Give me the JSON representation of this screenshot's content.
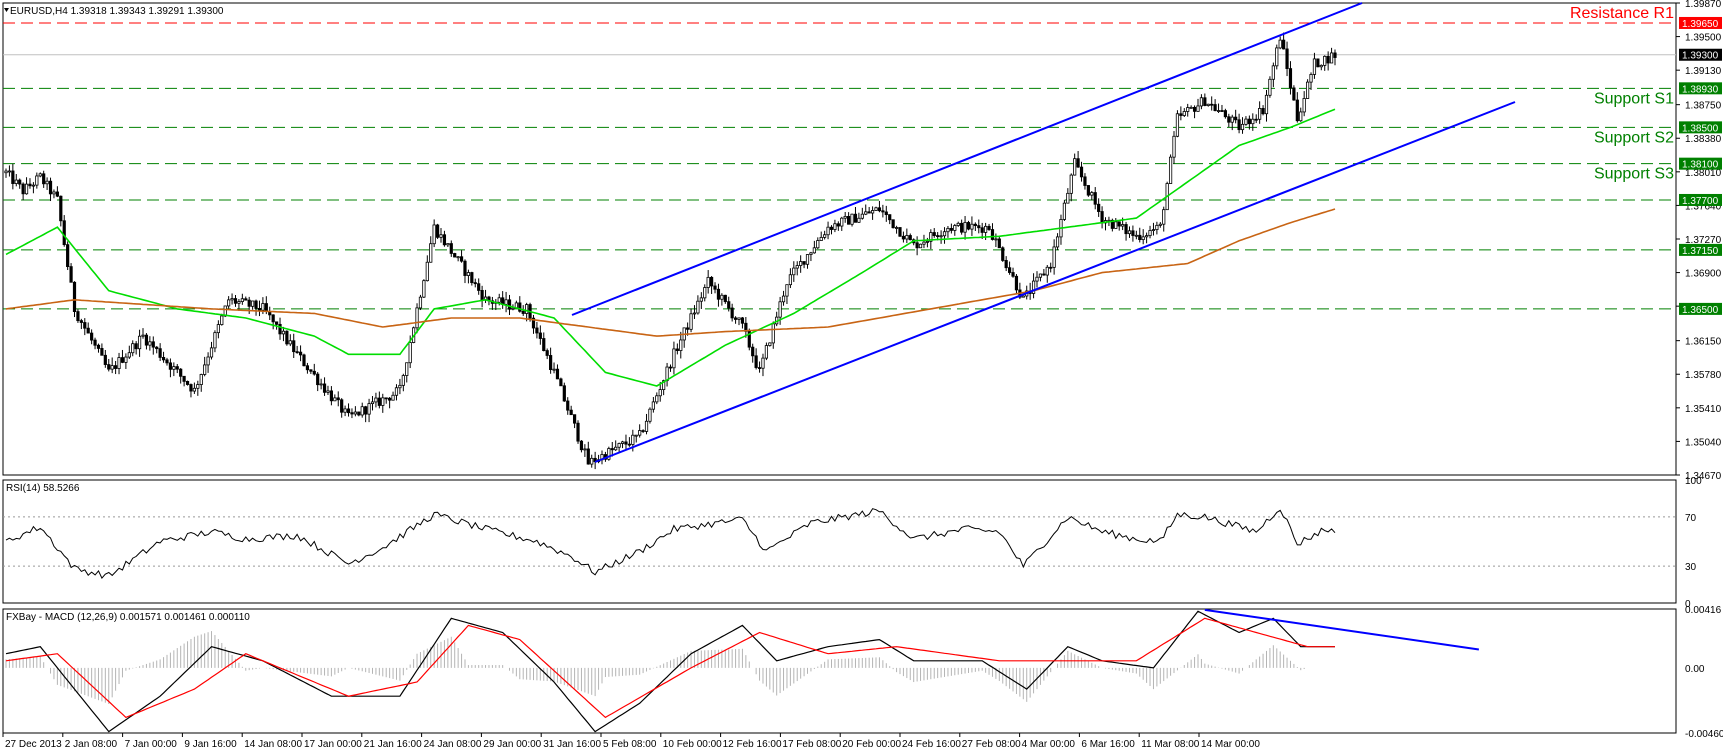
{
  "header": {
    "symbol_line": "EURUSD,H4  1.39318 1.39343 1.39291 1.39300",
    "rsi_label": "RSI(14) 58.5266",
    "macd_label": "FXBay - MACD (12,26,9) 0.001571 0.001461 0.000110"
  },
  "levels": {
    "resistance_r1": {
      "label": "Resistance R1",
      "value": 1.3965,
      "tag": "1.39650"
    },
    "support_s1": {
      "label": "Support S1",
      "value": 1.3893,
      "tag": "1.38930"
    },
    "support_s2": {
      "label": "Support S2",
      "value": 1.385,
      "tag": "1.38500"
    },
    "support_s3": {
      "label": "Support S3",
      "value": 1.381,
      "tag": "1.38100"
    },
    "level_1": {
      "value": 1.377,
      "tag": "1.37700"
    },
    "level_2": {
      "value": 1.3715,
      "tag": "1.37150"
    },
    "level_3": {
      "value": 1.365,
      "tag": "1.36500"
    },
    "current": {
      "value": 1.393,
      "tag": "1.39300"
    }
  },
  "colors": {
    "resistance": "#ff0000",
    "support": "#008000",
    "channel": "#0000ff",
    "ma_fast": "#00dd00",
    "ma_slow": "#c86414",
    "macd_signal": "#ff0000",
    "macd_main": "#000000",
    "histogram": "#b4b4b4"
  },
  "chart_data": [
    {
      "type": "candlestick",
      "title": "EURUSD,H4",
      "ylim": [
        1.3467,
        1.3987
      ],
      "y_ticks": [
        "1.39870",
        "1.39500",
        "1.39130",
        "1.38750",
        "1.38380",
        "1.38010",
        "1.37640",
        "1.37270",
        "1.36900",
        "1.36530",
        "1.36150",
        "1.35780",
        "1.35410",
        "1.35040",
        "1.34670"
      ],
      "x_ticks": [
        "27 Dec 2013",
        "2 Jan 08:00",
        "7 Jan 00:00",
        "9 Jan 16:00",
        "14 Jan 08:00",
        "17 Jan 00:00",
        "21 Jan 16:00",
        "24 Jan 08:00",
        "29 Jan 00:00",
        "31 Jan 16:00",
        "5 Feb 08:00",
        "10 Feb 00:00",
        "12 Feb 16:00",
        "17 Feb 08:00",
        "20 Feb 00:00",
        "24 Feb 16:00",
        "27 Feb 08:00",
        "4 Mar 00:00",
        "6 Mar 16:00",
        "11 Mar 08:00",
        "14 Mar 00:00"
      ],
      "price_keypoints": [
        [
          0,
          1.38
        ],
        [
          5,
          1.378
        ],
        [
          10,
          1.3795
        ],
        [
          15,
          1.377
        ],
        [
          20,
          1.365
        ],
        [
          30,
          1.358
        ],
        [
          40,
          1.362
        ],
        [
          55,
          1.356
        ],
        [
          65,
          1.366
        ],
        [
          75,
          1.365
        ],
        [
          85,
          1.36
        ],
        [
          100,
          1.353
        ],
        [
          115,
          1.356
        ],
        [
          125,
          1.374
        ],
        [
          140,
          1.366
        ],
        [
          152,
          1.365
        ],
        [
          160,
          1.358
        ],
        [
          170,
          1.348
        ],
        [
          185,
          1.351
        ],
        [
          195,
          1.36
        ],
        [
          205,
          1.368
        ],
        [
          215,
          1.363
        ],
        [
          220,
          1.358
        ],
        [
          228,
          1.368
        ],
        [
          240,
          1.374
        ],
        [
          255,
          1.376
        ],
        [
          265,
          1.372
        ],
        [
          275,
          1.374
        ],
        [
          287,
          1.374
        ],
        [
          297,
          1.366
        ],
        [
          305,
          1.37
        ],
        [
          312,
          1.381
        ],
        [
          320,
          1.375
        ],
        [
          330,
          1.373
        ],
        [
          337,
          1.374
        ],
        [
          342,
          1.386
        ],
        [
          350,
          1.388
        ],
        [
          360,
          1.385
        ],
        [
          367,
          1.387
        ],
        [
          372,
          1.395
        ],
        [
          377,
          1.386
        ],
        [
          382,
          1.392
        ],
        [
          388,
          1.393
        ]
      ],
      "series": [
        {
          "name": "MA fast",
          "keypoints": [
            [
              0,
              1.371
            ],
            [
              15,
              1.374
            ],
            [
              30,
              1.367
            ],
            [
              50,
              1.365
            ],
            [
              70,
              1.364
            ],
            [
              90,
              1.362
            ],
            [
              100,
              1.36
            ],
            [
              115,
              1.36
            ],
            [
              125,
              1.365
            ],
            [
              140,
              1.366
            ],
            [
              160,
              1.364
            ],
            [
              175,
              1.358
            ],
            [
              190,
              1.3565
            ],
            [
              210,
              1.361
            ],
            [
              230,
              1.3645
            ],
            [
              250,
              1.369
            ],
            [
              265,
              1.3725
            ],
            [
              290,
              1.373
            ],
            [
              310,
              1.374
            ],
            [
              330,
              1.375
            ],
            [
              345,
              1.379
            ],
            [
              360,
              1.383
            ],
            [
              375,
              1.385
            ],
            [
              388,
              1.387
            ]
          ]
        },
        {
          "name": "MA slow",
          "keypoints": [
            [
              0,
              1.365
            ],
            [
              20,
              1.366
            ],
            [
              40,
              1.3655
            ],
            [
              60,
              1.365
            ],
            [
              90,
              1.3645
            ],
            [
              110,
              1.363
            ],
            [
              130,
              1.364
            ],
            [
              150,
              1.364
            ],
            [
              170,
              1.363
            ],
            [
              190,
              1.362
            ],
            [
              210,
              1.3625
            ],
            [
              240,
              1.363
            ],
            [
              270,
              1.365
            ],
            [
              300,
              1.367
            ],
            [
              320,
              1.369
            ],
            [
              345,
              1.37
            ],
            [
              360,
              1.3725
            ],
            [
              375,
              1.3745
            ],
            [
              388,
              1.376
            ]
          ]
        }
      ]
    },
    {
      "type": "line",
      "title": "RSI(14) 58.5266",
      "ylim": [
        0,
        100
      ],
      "y_ticks": [
        "100",
        "70",
        "30",
        "0"
      ],
      "keypoints": [
        [
          0,
          50
        ],
        [
          10,
          62
        ],
        [
          20,
          28
        ],
        [
          30,
          22
        ],
        [
          45,
          50
        ],
        [
          60,
          58
        ],
        [
          70,
          52
        ],
        [
          85,
          55
        ],
        [
          100,
          32
        ],
        [
          110,
          45
        ],
        [
          125,
          72
        ],
        [
          140,
          60
        ],
        [
          155,
          50
        ],
        [
          165,
          38
        ],
        [
          172,
          25
        ],
        [
          185,
          42
        ],
        [
          195,
          60
        ],
        [
          215,
          68
        ],
        [
          222,
          42
        ],
        [
          235,
          65
        ],
        [
          255,
          75
        ],
        [
          265,
          52
        ],
        [
          280,
          60
        ],
        [
          290,
          58
        ],
        [
          297,
          30
        ],
        [
          310,
          70
        ],
        [
          320,
          58
        ],
        [
          330,
          52
        ],
        [
          337,
          50
        ],
        [
          342,
          72
        ],
        [
          350,
          70
        ],
        [
          365,
          58
        ],
        [
          372,
          78
        ],
        [
          377,
          48
        ],
        [
          385,
          60
        ],
        [
          388,
          58
        ]
      ]
    },
    {
      "type": "line",
      "title": "FXBay - MACD (12,26,9)",
      "ylim": [
        -0.0046,
        0.00416
      ],
      "y_ticks": [
        "0.00416",
        "0.00",
        "-0.004601"
      ],
      "series": [
        {
          "name": "MACD",
          "keypoints": [
            [
              0,
              0.001
            ],
            [
              10,
              0.0015
            ],
            [
              30,
              -0.0045
            ],
            [
              45,
              -0.002
            ],
            [
              60,
              0.0015
            ],
            [
              75,
              0.0005
            ],
            [
              95,
              -0.002
            ],
            [
              115,
              -0.002
            ],
            [
              130,
              0.0035
            ],
            [
              145,
              0.0025
            ],
            [
              160,
              -0.001
            ],
            [
              172,
              -0.0045
            ],
            [
              185,
              -0.0025
            ],
            [
              200,
              0.001
            ],
            [
              215,
              0.003
            ],
            [
              225,
              0.0005
            ],
            [
              240,
              0.0015
            ],
            [
              255,
              0.002
            ],
            [
              265,
              0.0005
            ],
            [
              285,
              0.0005
            ],
            [
              298,
              -0.0015
            ],
            [
              310,
              0.0015
            ],
            [
              320,
              0.0005
            ],
            [
              335,
              0.0
            ],
            [
              348,
              0.004
            ],
            [
              360,
              0.0025
            ],
            [
              370,
              0.0035
            ],
            [
              378,
              0.0015
            ],
            [
              388,
              0.0015
            ]
          ]
        },
        {
          "name": "Signal",
          "keypoints": [
            [
              0,
              0.0005
            ],
            [
              15,
              0.001
            ],
            [
              35,
              -0.0035
            ],
            [
              55,
              -0.0015
            ],
            [
              70,
              0.001
            ],
            [
              100,
              -0.002
            ],
            [
              120,
              -0.001
            ],
            [
              135,
              0.003
            ],
            [
              150,
              0.002
            ],
            [
              175,
              -0.0035
            ],
            [
              200,
              0.0
            ],
            [
              220,
              0.0025
            ],
            [
              240,
              0.001
            ],
            [
              260,
              0.0015
            ],
            [
              290,
              0.0005
            ],
            [
              305,
              0.0005
            ],
            [
              330,
              0.0005
            ],
            [
              350,
              0.0035
            ],
            [
              365,
              0.0025
            ],
            [
              380,
              0.0015
            ],
            [
              388,
              0.0015
            ]
          ]
        }
      ],
      "trend_line": [
        [
          350,
          0.0041
        ],
        [
          430,
          0.0013
        ]
      ]
    }
  ]
}
